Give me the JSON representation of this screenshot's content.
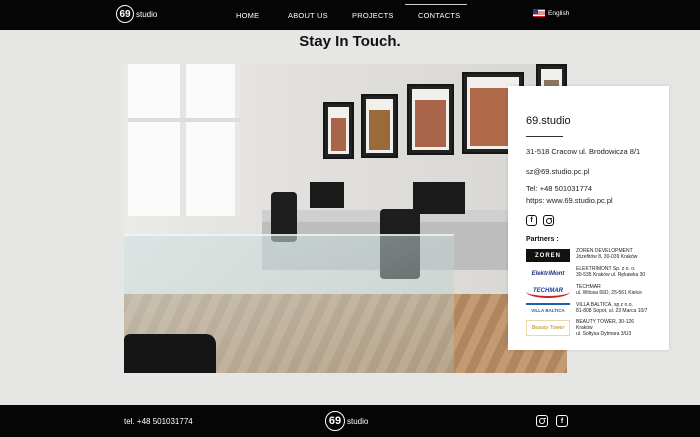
{
  "header": {
    "logo_number": "69",
    "logo_word": "studio",
    "nav": [
      {
        "label": "HOME",
        "active": false
      },
      {
        "label": "ABOUT US",
        "active": false
      },
      {
        "label": "PROJECTS",
        "active": false
      },
      {
        "label": "CONTACTS",
        "active": true
      }
    ],
    "language": "English",
    "flag_icon": "us-flag-icon"
  },
  "page": {
    "title": "Stay In Touch."
  },
  "contact_card": {
    "title": "69.studio",
    "address": "31-518 Cracow ul. Brodowicza 8/1",
    "email": "sz@69.studio.pc.pl",
    "tel": "Tel: +48 501031774",
    "website": "https: www.69.studio.pc.pl",
    "social_icons": [
      "facebook-icon",
      "instagram-icon"
    ],
    "partners_label": "Partners :",
    "partners": [
      {
        "logo": "ZOREN",
        "line1": "ZOREN DEVELOPMENT",
        "line2": "Józefitów 8, 30-039 Kraków",
        "line3": "",
        "color": "#111111"
      },
      {
        "logo": "ElektriMont",
        "line1": "ELEKTRIMONT Sp. z o. o.",
        "line2": "30-535 Kraków ul. Rękawka 30",
        "line3": "",
        "color": "#1b2f7a"
      },
      {
        "logo": "TECHMAR",
        "line1": "TECHMAR",
        "line2": "ul. Witosa 66D, 25-561 Kielce",
        "line3": "",
        "color": "#1a3f8f"
      },
      {
        "logo": "VILLA BALTICA",
        "line1": "VILLA BALTICA, sp z o.o.",
        "line2": "81-808 Sopot, ul. 23 Marca 10/7",
        "line3": "",
        "color": "#1f5fa8"
      },
      {
        "logo": "Beauty Tower",
        "line1": "BEAUTY TOWER, 30-126",
        "line2": "Kraków",
        "line3": "ul. Sołtysa Dytmara 3/U3",
        "color": "#c9a64a"
      }
    ]
  },
  "footer": {
    "tel": "tel. +48 501031774",
    "logo_number": "69",
    "logo_word": "studio",
    "social_icons": [
      "instagram-icon",
      "facebook-icon"
    ]
  }
}
